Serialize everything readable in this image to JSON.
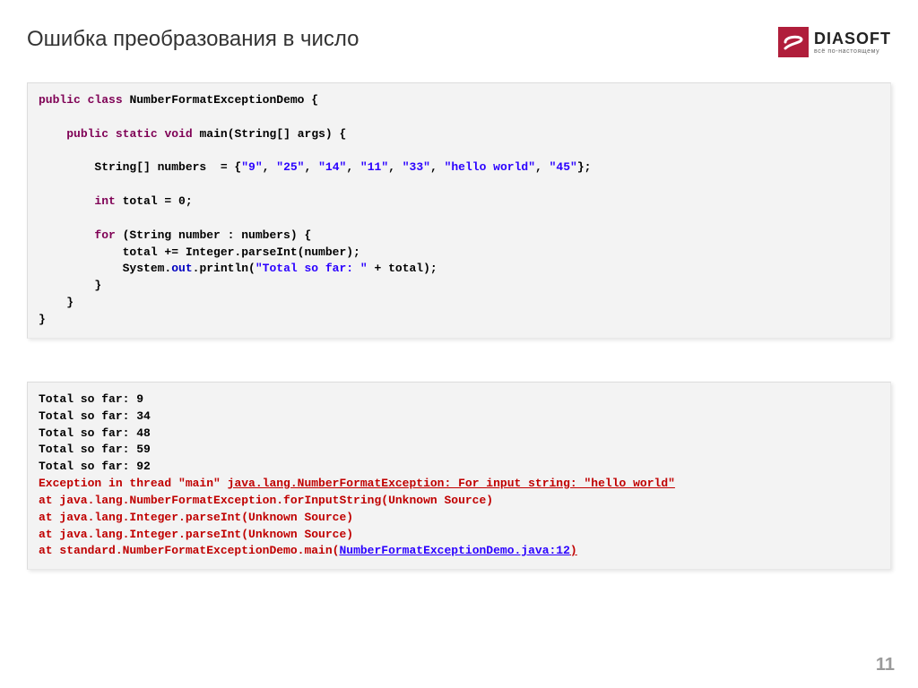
{
  "title": "Ошибка преобразования в число",
  "logo": {
    "brand": "DIASOFT",
    "tagline": "всё по-настоящему"
  },
  "page_number": "11",
  "code": {
    "class_decl": {
      "kw1": "public",
      "kw2": "class",
      "name": "NumberFormatExceptionDemo {"
    },
    "main_decl": {
      "kw1": "public",
      "kw2": "static",
      "kw3": "void",
      "rest": "main(String[] args) {"
    },
    "arr_line": {
      "prefix": "        String[] numbers  = {",
      "s1": "\"9\"",
      "s2": "\"25\"",
      "s3": "\"14\"",
      "s4": "\"11\"",
      "s5": "\"33\"",
      "s6": "\"hello world\"",
      "s7": "\"45\"",
      "comma": ", ",
      "suffix": "};"
    },
    "total_line": {
      "kw": "int",
      "rest": " total = 0;"
    },
    "for_line": {
      "kw": "for",
      "rest": " (String number : numbers) {"
    },
    "accum_line": "            total += Integer.parseInt(number);",
    "println_line": {
      "prefix": "            System.",
      "out": "out",
      "mid": ".println(",
      "str": "\"Total so far: \"",
      "suffix": " + total);"
    },
    "close_for": "        }",
    "close_main": "    }",
    "close_class": "}"
  },
  "output": {
    "l1": "Total so far: 9",
    "l2": "Total so far: 34",
    "l3": "Total so far: 48",
    "l4": "Total so far: 59",
    "l5": "Total so far: 92",
    "exc_prefix": "Exception in thread \"main\" ",
    "exc_link": "java.lang.NumberFormatException",
    "exc_rest": ": For input string: \"hello world\"",
    "st1": "at java.lang.NumberFormatException.forInputString(Unknown Source)",
    "st2": "at java.lang.Integer.parseInt(Unknown Source)",
    "st3": "at java.lang.Integer.parseInt(Unknown Source)",
    "st4_prefix": "at standard.NumberFormatExceptionDemo.main(",
    "st4_link": "NumberFormatExceptionDemo.java:12",
    "st4_close": ")"
  }
}
